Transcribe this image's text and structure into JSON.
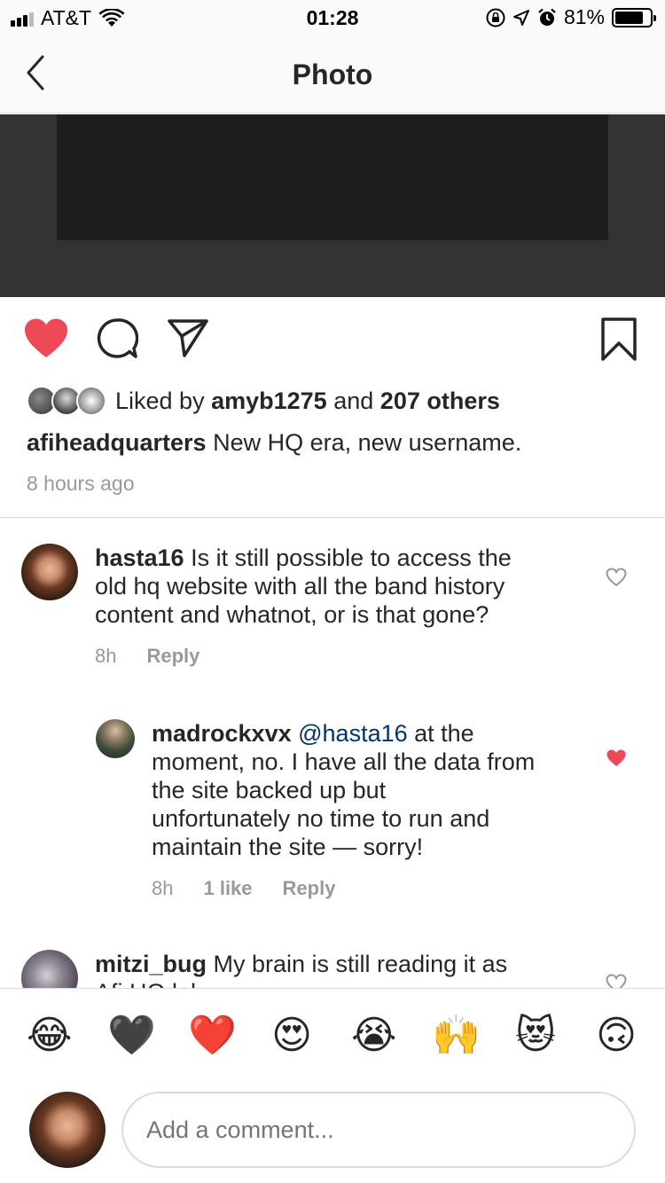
{
  "status_bar": {
    "carrier": "AT&T",
    "time": "01:28",
    "battery_percent": "81%",
    "battery_level": 0.81
  },
  "nav": {
    "title": "Photo"
  },
  "post": {
    "liked": true,
    "likes": {
      "prefix": "Liked by",
      "user": "amyb1275",
      "joiner": "and",
      "others": "207 others"
    },
    "caption": {
      "username": "afiheadquarters",
      "text": "New HQ era, new username."
    },
    "time_ago": "8 hours ago"
  },
  "comments": [
    {
      "username": "hasta16",
      "text": "Is it still possible to access the old hq website with all the band history content and whatnot, or is that gone?",
      "lines": [
        "Is it still possible to access the",
        "old hq website with all the band history",
        "content and whatnot, or is that gone?"
      ],
      "time": "8h",
      "reply_label": "Reply",
      "liked": false
    },
    {
      "username": "madrockxvx",
      "mention": "@hasta16",
      "text": "at the moment, no. I have all the data from the site backed up but unfortunately no time to run and maintain the site — sorry!",
      "lines": [
        "at the",
        "moment, no. I have all the data from",
        "the site backed up but",
        "unfortunately no time to run and",
        "maintain the site — sorry!"
      ],
      "time": "8h",
      "likes": "1 like",
      "reply_label": "Reply",
      "liked": true
    },
    {
      "username": "mitzi_bug",
      "text": "My brain is still reading it as",
      "lines": [
        "My brain is still reading it as",
        "Afi HQ lol"
      ],
      "liked": false
    }
  ],
  "emoji_bar": [
    "😂",
    "🖤",
    "❤️",
    "😍",
    "😭",
    "🙌",
    "😻",
    "🙃"
  ],
  "composer": {
    "placeholder": "Add a comment..."
  },
  "colors": {
    "heart_red": "#ed4956",
    "mention_blue": "#003569",
    "muted_gray": "#999999"
  }
}
